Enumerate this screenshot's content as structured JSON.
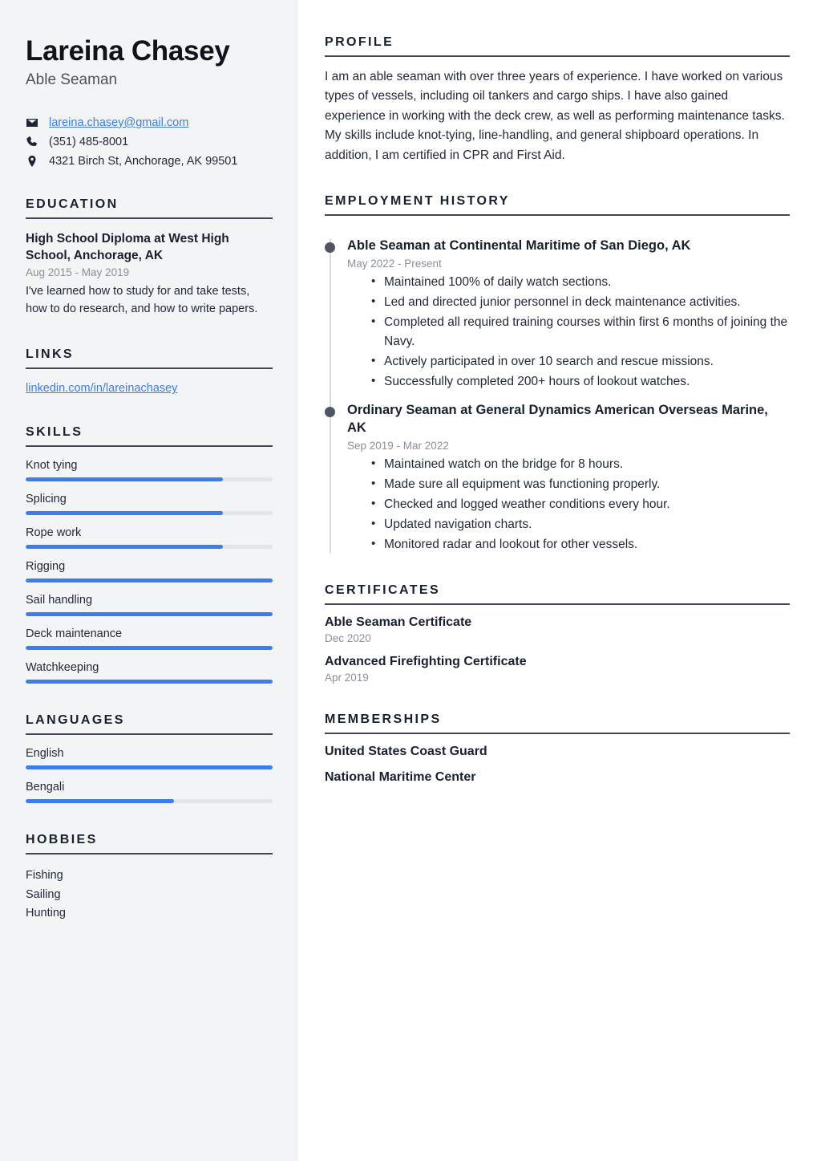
{
  "theme": {
    "sidebar_bg": "#f2f4f6",
    "accent": "#3b7ded",
    "heading_color": "#18202e",
    "muted_color": "#8a9099",
    "timeline_dot": "#4e5663"
  },
  "header": {
    "name": "Lareina Chasey",
    "job_title": "Able Seaman",
    "contact": [
      {
        "icon": "envelope-icon",
        "label": "lareina.chasey@gmail.com",
        "is_link": true
      },
      {
        "icon": "phone-icon",
        "label": "(351) 485-8001",
        "is_link": false
      },
      {
        "icon": "map-pin-icon",
        "label": "4321 Birch St, Anchorage, AK 99501",
        "is_link": false
      }
    ]
  },
  "sidebar": {
    "education": {
      "heading": "EDUCATION",
      "items": [
        {
          "title": "High School Diploma at West High School, Anchorage, AK",
          "date": "Aug 2015 - May 2019",
          "description": "I've learned how to study for and take tests, how to do research, and how to write papers."
        }
      ]
    },
    "links": {
      "heading": "LINKS",
      "items": [
        {
          "label": "linkedin.com/in/lareinachasey"
        }
      ]
    },
    "skills": {
      "heading": "SKILLS",
      "items": [
        {
          "label": "Knot tying",
          "level": 80
        },
        {
          "label": "Splicing",
          "level": 80
        },
        {
          "label": "Rope work",
          "level": 80
        },
        {
          "label": "Rigging",
          "level": 100
        },
        {
          "label": "Sail handling",
          "level": 100
        },
        {
          "label": "Deck maintenance",
          "level": 100
        },
        {
          "label": "Watchkeeping",
          "level": 100
        }
      ]
    },
    "languages": {
      "heading": "LANGUAGES",
      "items": [
        {
          "label": "English",
          "level": 100
        },
        {
          "label": "Bengali",
          "level": 60
        }
      ]
    },
    "hobbies": {
      "heading": "HOBBIES",
      "items": [
        {
          "label": "Fishing"
        },
        {
          "label": "Sailing"
        },
        {
          "label": "Hunting"
        }
      ]
    }
  },
  "main": {
    "profile": {
      "heading": "PROFILE",
      "text": "I am an able seaman with over three years of experience. I have worked on various types of vessels, including oil tankers and cargo ships. I have also gained experience in working with the deck crew, as well as performing maintenance tasks. My skills include knot-tying, line-handling, and general shipboard operations. In addition, I am certified in CPR and First Aid."
    },
    "employment": {
      "heading": "EMPLOYMENT HISTORY",
      "jobs": [
        {
          "title": "Able Seaman at Continental Maritime of San Diego, AK",
          "date": "May 2022 - Present",
          "bullets": [
            "Maintained 100% of daily watch sections.",
            "Led and directed junior personnel in deck maintenance activities.",
            "Completed all required training courses within first 6 months of joining the Navy.",
            "Actively participated in over 10 search and rescue missions.",
            "Successfully completed 200+ hours of lookout watches."
          ]
        },
        {
          "title": "Ordinary Seaman at General Dynamics American Overseas Marine, AK",
          "date": "Sep 2019 - Mar 2022",
          "bullets": [
            "Maintained watch on the bridge for 8 hours.",
            "Made sure all equipment was functioning properly.",
            "Checked and logged weather conditions every hour.",
            "Updated navigation charts.",
            "Monitored radar and lookout for other vessels."
          ]
        }
      ]
    },
    "certificates": {
      "heading": "CERTIFICATES",
      "items": [
        {
          "name": "Able Seaman Certificate",
          "date": "Dec 2020"
        },
        {
          "name": "Advanced Firefighting Certificate",
          "date": "Apr 2019"
        }
      ]
    },
    "memberships": {
      "heading": "MEMBERSHIPS",
      "items": [
        {
          "name": "United States Coast Guard"
        },
        {
          "name": "National Maritime Center"
        }
      ]
    }
  }
}
